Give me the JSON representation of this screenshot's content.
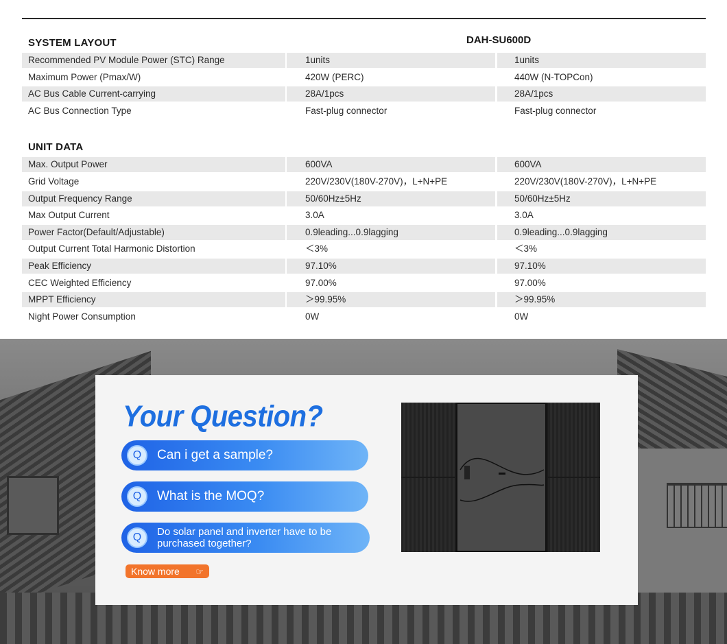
{
  "sections": [
    {
      "title": "SYSTEM LAYOUT",
      "model": "DAH-SU600D",
      "rows": [
        {
          "label": "Recommended PV Module Power (STC) Range",
          "v1": "1units",
          "v2": "1units",
          "shade": true
        },
        {
          "label": "Maximum Power (Pmax/W)",
          "v1": "420W (PERC)",
          "v2": "440W (N-TOPCon)",
          "shade": false
        },
        {
          "label": "AC Bus Cable Current-carrying",
          "v1": "28A/1pcs",
          "v2": "28A/1pcs",
          "shade": true
        },
        {
          "label": "AC Bus Connection Type",
          "v1": "Fast-plug connector",
          "v2": "Fast-plug connector",
          "shade": false
        }
      ]
    },
    {
      "title": "UNIT DATA",
      "model": "",
      "rows": [
        {
          "label": "Max. Output Power",
          "v1": "600VA",
          "v2": "600VA",
          "shade": true
        },
        {
          "label": "Grid Voltage",
          "v1": "220V/230V(180V-270V)，L+N+PE",
          "v2": "220V/230V(180V-270V)，L+N+PE",
          "shade": false
        },
        {
          "label": "Output Frequency Range",
          "v1": "50/60Hz±5Hz",
          "v2": "50/60Hz±5Hz",
          "shade": true
        },
        {
          "label": "Max Output Current",
          "v1": "3.0A",
          "v2": "3.0A",
          "shade": false
        },
        {
          "label": "Power Factor(Default/Adjustable)",
          "v1": "0.9leading...0.9lagging",
          "v2": "0.9leading...0.9lagging",
          "shade": true
        },
        {
          "label": "Output Current Total Harmonic Distortion",
          "v1": "＜3%",
          "v2": "＜3%",
          "shade": false
        },
        {
          "label": "Peak Efficiency",
          "v1": "97.10%",
          "v2": "97.10%",
          "shade": true
        },
        {
          "label": "CEC Weighted Efficiency",
          "v1": "97.00%",
          "v2": "97.00%",
          "shade": false
        },
        {
          "label": "MPPT Efficiency",
          "v1": "＞99.95%",
          "v2": "＞99.95%",
          "shade": true
        },
        {
          "label": "Night Power Consumption",
          "v1": "0W",
          "v2": "0W",
          "shade": false
        }
      ]
    }
  ],
  "faq": {
    "title": "Your Question?",
    "badge": "Q",
    "questions": [
      "Can i get a sample?",
      "What is the MOQ?",
      "Do solar panel and inverter have to be purchased together?"
    ],
    "cta": "Know more",
    "cta_icon": "pointer-hand-icon"
  },
  "colors": {
    "accent_blue": "#1e6fe0",
    "cta_orange": "#f2742b",
    "row_shade": "#e8e8e8"
  }
}
